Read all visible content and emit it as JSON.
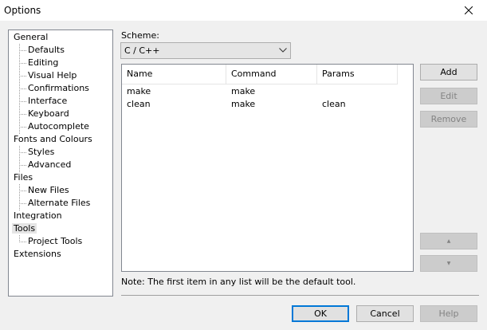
{
  "window": {
    "title": "Options"
  },
  "tree": {
    "items": [
      {
        "label": "General",
        "level": 0
      },
      {
        "label": "Defaults",
        "level": 1
      },
      {
        "label": "Editing",
        "level": 1
      },
      {
        "label": "Visual Help",
        "level": 1
      },
      {
        "label": "Confirmations",
        "level": 1
      },
      {
        "label": "Interface",
        "level": 1
      },
      {
        "label": "Keyboard",
        "level": 1
      },
      {
        "label": "Autocomplete",
        "level": 1
      },
      {
        "label": "Fonts and Colours",
        "level": 0
      },
      {
        "label": "Styles",
        "level": 1
      },
      {
        "label": "Advanced",
        "level": 1
      },
      {
        "label": "Files",
        "level": 0
      },
      {
        "label": "New Files",
        "level": 1
      },
      {
        "label": "Alternate Files",
        "level": 1
      },
      {
        "label": "Integration",
        "level": 0
      },
      {
        "label": "Tools",
        "level": 0,
        "selected": true
      },
      {
        "label": "Project Tools",
        "level": 1
      },
      {
        "label": "Extensions",
        "level": 0
      }
    ]
  },
  "scheme": {
    "label": "Scheme:",
    "value": "C / C++"
  },
  "tools_list": {
    "columns": [
      "Name",
      "Command",
      "Params"
    ],
    "rows": [
      {
        "name": "make",
        "command": "make",
        "params": ""
      },
      {
        "name": "clean",
        "command": "make",
        "params": "clean"
      }
    ]
  },
  "side_buttons": {
    "add": "Add",
    "edit": "Edit",
    "remove": "Remove",
    "move_up": "▲",
    "move_down": "▼"
  },
  "note": "Note: The first item in any list will be the default tool.",
  "footer": {
    "ok": "OK",
    "cancel": "Cancel",
    "help": "Help"
  },
  "colors": {
    "default_button_border": "#0078d7",
    "tree_selection": "#e5e5e5"
  }
}
